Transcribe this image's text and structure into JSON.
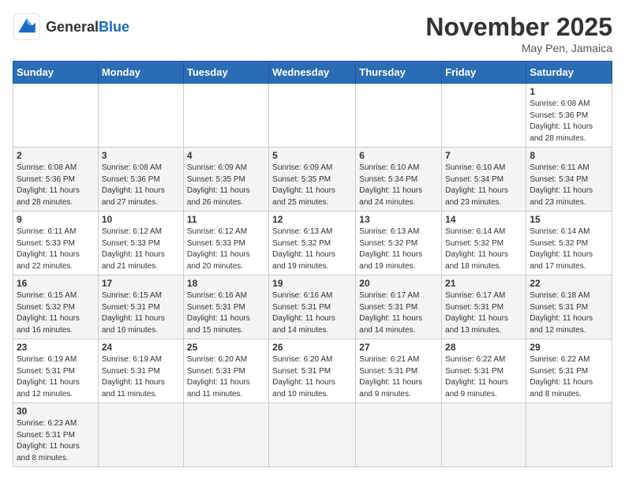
{
  "header": {
    "logo_general": "General",
    "logo_blue": "Blue",
    "month_title": "November 2025",
    "location": "May Pen, Jamaica"
  },
  "weekdays": [
    "Sunday",
    "Monday",
    "Tuesday",
    "Wednesday",
    "Thursday",
    "Friday",
    "Saturday"
  ],
  "weeks": [
    [
      {
        "date": "",
        "info": ""
      },
      {
        "date": "",
        "info": ""
      },
      {
        "date": "",
        "info": ""
      },
      {
        "date": "",
        "info": ""
      },
      {
        "date": "",
        "info": ""
      },
      {
        "date": "",
        "info": ""
      },
      {
        "date": "1",
        "info": "Sunrise: 6:08 AM\nSunset: 5:36 PM\nDaylight: 11 hours\nand 28 minutes."
      }
    ],
    [
      {
        "date": "2",
        "info": "Sunrise: 6:08 AM\nSunset: 5:36 PM\nDaylight: 11 hours\nand 28 minutes."
      },
      {
        "date": "3",
        "info": "Sunrise: 6:08 AM\nSunset: 5:36 PM\nDaylight: 11 hours\nand 27 minutes."
      },
      {
        "date": "4",
        "info": "Sunrise: 6:09 AM\nSunset: 5:35 PM\nDaylight: 11 hours\nand 26 minutes."
      },
      {
        "date": "5",
        "info": "Sunrise: 6:09 AM\nSunset: 5:35 PM\nDaylight: 11 hours\nand 25 minutes."
      },
      {
        "date": "6",
        "info": "Sunrise: 6:10 AM\nSunset: 5:34 PM\nDaylight: 11 hours\nand 24 minutes."
      },
      {
        "date": "7",
        "info": "Sunrise: 6:10 AM\nSunset: 5:34 PM\nDaylight: 11 hours\nand 23 minutes."
      },
      {
        "date": "8",
        "info": "Sunrise: 6:11 AM\nSunset: 5:34 PM\nDaylight: 11 hours\nand 23 minutes."
      }
    ],
    [
      {
        "date": "9",
        "info": "Sunrise: 6:11 AM\nSunset: 5:33 PM\nDaylight: 11 hours\nand 22 minutes."
      },
      {
        "date": "10",
        "info": "Sunrise: 6:12 AM\nSunset: 5:33 PM\nDaylight: 11 hours\nand 21 minutes."
      },
      {
        "date": "11",
        "info": "Sunrise: 6:12 AM\nSunset: 5:33 PM\nDaylight: 11 hours\nand 20 minutes."
      },
      {
        "date": "12",
        "info": "Sunrise: 6:13 AM\nSunset: 5:32 PM\nDaylight: 11 hours\nand 19 minutes."
      },
      {
        "date": "13",
        "info": "Sunrise: 6:13 AM\nSunset: 5:32 PM\nDaylight: 11 hours\nand 19 minutes."
      },
      {
        "date": "14",
        "info": "Sunrise: 6:14 AM\nSunset: 5:32 PM\nDaylight: 11 hours\nand 18 minutes."
      },
      {
        "date": "15",
        "info": "Sunrise: 6:14 AM\nSunset: 5:32 PM\nDaylight: 11 hours\nand 17 minutes."
      }
    ],
    [
      {
        "date": "16",
        "info": "Sunrise: 6:15 AM\nSunset: 5:32 PM\nDaylight: 11 hours\nand 16 minutes."
      },
      {
        "date": "17",
        "info": "Sunrise: 6:15 AM\nSunset: 5:31 PM\nDaylight: 11 hours\nand 16 minutes."
      },
      {
        "date": "18",
        "info": "Sunrise: 6:16 AM\nSunset: 5:31 PM\nDaylight: 11 hours\nand 15 minutes."
      },
      {
        "date": "19",
        "info": "Sunrise: 6:16 AM\nSunset: 5:31 PM\nDaylight: 11 hours\nand 14 minutes."
      },
      {
        "date": "20",
        "info": "Sunrise: 6:17 AM\nSunset: 5:31 PM\nDaylight: 11 hours\nand 14 minutes."
      },
      {
        "date": "21",
        "info": "Sunrise: 6:17 AM\nSunset: 5:31 PM\nDaylight: 11 hours\nand 13 minutes."
      },
      {
        "date": "22",
        "info": "Sunrise: 6:18 AM\nSunset: 5:31 PM\nDaylight: 11 hours\nand 12 minutes."
      }
    ],
    [
      {
        "date": "23",
        "info": "Sunrise: 6:19 AM\nSunset: 5:31 PM\nDaylight: 11 hours\nand 12 minutes."
      },
      {
        "date": "24",
        "info": "Sunrise: 6:19 AM\nSunset: 5:31 PM\nDaylight: 11 hours\nand 11 minutes."
      },
      {
        "date": "25",
        "info": "Sunrise: 6:20 AM\nSunset: 5:31 PM\nDaylight: 11 hours\nand 11 minutes."
      },
      {
        "date": "26",
        "info": "Sunrise: 6:20 AM\nSunset: 5:31 PM\nDaylight: 11 hours\nand 10 minutes."
      },
      {
        "date": "27",
        "info": "Sunrise: 6:21 AM\nSunset: 5:31 PM\nDaylight: 11 hours\nand 9 minutes."
      },
      {
        "date": "28",
        "info": "Sunrise: 6:22 AM\nSunset: 5:31 PM\nDaylight: 11 hours\nand 9 minutes."
      },
      {
        "date": "29",
        "info": "Sunrise: 6:22 AM\nSunset: 5:31 PM\nDaylight: 11 hours\nand 8 minutes."
      }
    ],
    [
      {
        "date": "30",
        "info": "Sunrise: 6:23 AM\nSunset: 5:31 PM\nDaylight: 11 hours\nand 8 minutes."
      },
      {
        "date": "",
        "info": ""
      },
      {
        "date": "",
        "info": ""
      },
      {
        "date": "",
        "info": ""
      },
      {
        "date": "",
        "info": ""
      },
      {
        "date": "",
        "info": ""
      },
      {
        "date": "",
        "info": ""
      }
    ]
  ]
}
